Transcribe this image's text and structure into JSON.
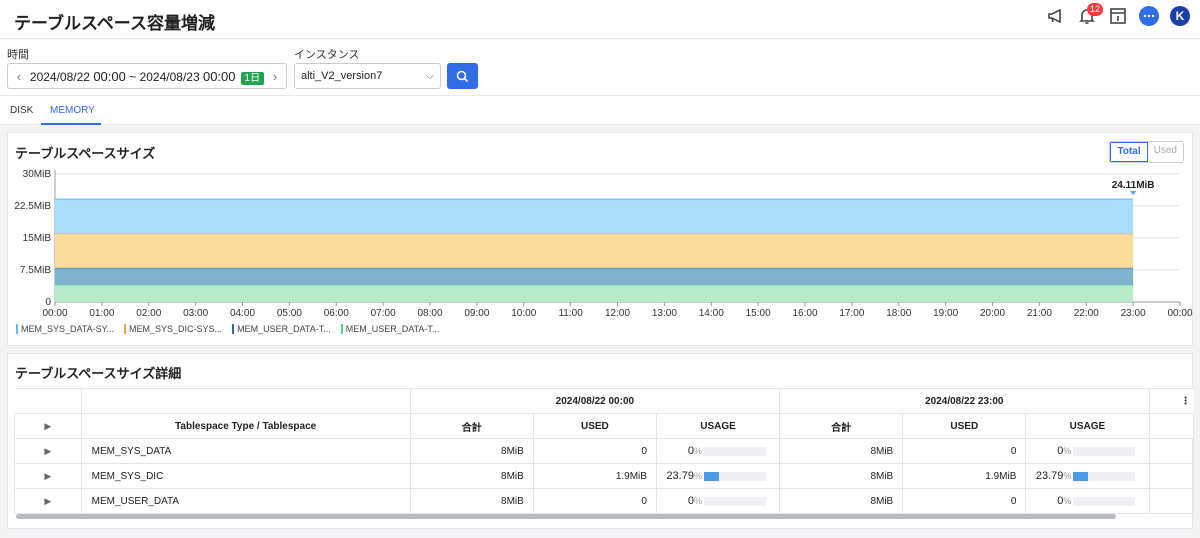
{
  "header": {
    "title": "テーブルスペース容量増減",
    "notification_count": "12",
    "avatar_initial": "K"
  },
  "filters": {
    "time_label": "時間",
    "date_from": "2024/08/22",
    "time_from": "00:00",
    "range_sep": "~",
    "date_to": "2024/08/23",
    "time_to": "00:00",
    "range_tag": "1日",
    "instance_label": "インスタンス",
    "instance_value": "alti_V2_version7"
  },
  "tabs": [
    {
      "label": "DISK"
    },
    {
      "label": "MEMORY",
      "active": true
    }
  ],
  "size_chart": {
    "title": "テーブルスペースサイズ",
    "toggle_total": "Total",
    "toggle_used": "Used",
    "peak_label": "24.11MiB",
    "legend": [
      {
        "label": "MEM_SYS_DATA-SY...",
        "color": "#63b7ef"
      },
      {
        "label": "MEM_SYS_DIC-SYS...",
        "color": "#f0a748"
      },
      {
        "label": "MEM_USER_DATA-T...",
        "color": "#2a6f9c"
      },
      {
        "label": "MEM_USER_DATA-T...",
        "color": "#5fcf8c"
      }
    ]
  },
  "chart_data": {
    "type": "area",
    "stacked": true,
    "x": [
      "00:00",
      "01:00",
      "02:00",
      "03:00",
      "04:00",
      "05:00",
      "06:00",
      "07:00",
      "08:00",
      "09:00",
      "10:00",
      "11:00",
      "12:00",
      "13:00",
      "14:00",
      "15:00",
      "16:00",
      "17:00",
      "18:00",
      "19:00",
      "20:00",
      "21:00",
      "22:00",
      "23:00",
      "00:00"
    ],
    "yticks": [
      "30MiB",
      "22.5MiB",
      "15MiB",
      "7.5MiB",
      "0"
    ],
    "ylim": [
      0,
      30
    ],
    "series": [
      {
        "name": "MEM_USER_DATA-T...",
        "color": "#5fcf8c",
        "fill": "#b8ecc9",
        "value": 4.0
      },
      {
        "name": "MEM_USER_DATA-T...",
        "color": "#2a6f9c",
        "fill": "#7fb2cf",
        "value": 4.0
      },
      {
        "name": "MEM_SYS_DIC-SYS...",
        "color": "#f0a748",
        "fill": "#fbdb9a",
        "value": 8.0
      },
      {
        "name": "MEM_SYS_DATA-SY...",
        "color": "#63b7ef",
        "fill": "#a9ddfa",
        "value": 8.11
      }
    ],
    "data_points": 24,
    "grid": true
  },
  "detail": {
    "title": "テーブルスペースサイズ詳細",
    "period1": "2024/08/22 00:00",
    "period2": "2024/08/22 23:00",
    "col_tablespace": "Tablespace Type / Tablespace",
    "col_total": "合計",
    "col_used": "USED",
    "col_usage": "USAGE",
    "pct_sym": "%",
    "rows": [
      {
        "name": "MEM_SYS_DATA",
        "total1": "8MiB",
        "used1": "0",
        "usage1": "0",
        "usage1_value": 0,
        "total2": "8MiB",
        "used2": "0",
        "usage2": "0",
        "usage2_value": 0
      },
      {
        "name": "MEM_SYS_DIC",
        "total1": "8MiB",
        "used1": "1.9MiB",
        "usage1": "23.79",
        "usage1_value": 23.79,
        "total2": "8MiB",
        "used2": "1.9MiB",
        "usage2": "23.79",
        "usage2_value": 23.79
      },
      {
        "name": "MEM_USER_DATA",
        "total1": "8MiB",
        "used1": "0",
        "usage1": "0",
        "usage1_value": 0,
        "total2": "8MiB",
        "used2": "0",
        "usage2": "0",
        "usage2_value": 0
      }
    ]
  }
}
